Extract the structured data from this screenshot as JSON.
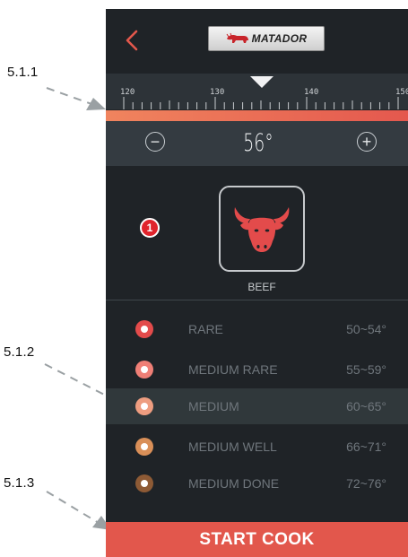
{
  "annotations": [
    {
      "label": "5.1.1"
    },
    {
      "label": "5.1.2"
    },
    {
      "label": "5.1.3"
    }
  ],
  "header": {
    "logo_text": "MATADOR",
    "icons": {
      "back": "chevron-left-icon",
      "logo": "bull-icon"
    }
  },
  "ruler": {
    "labels": [
      "120",
      "130",
      "140",
      "150"
    ],
    "pointer_icon": "triangle-down-icon"
  },
  "temperature": {
    "value": "56°",
    "minus": "−",
    "plus": "+"
  },
  "meat": {
    "badge": "1",
    "label": "BEEF",
    "icon": "bull-head-icon"
  },
  "doneness_levels": [
    {
      "name": "RARE",
      "range": "50~54°",
      "color": "#e34b4b"
    },
    {
      "name": "MEDIUM RARE",
      "range": "55~59°",
      "color": "#ef7f76"
    },
    {
      "name": "MEDIUM",
      "range": "60~65°",
      "color": "#ee9d80"
    },
    {
      "name": "MEDIUM WELL",
      "range": "66~71°",
      "color": "#d98f58"
    },
    {
      "name": "MEDIUM DONE",
      "range": "72~76°",
      "color": "#8d5a35"
    }
  ],
  "selected_level": "MEDIUM",
  "start_button": {
    "label": "START COOK"
  },
  "colors": {
    "accent": "#e2574c",
    "background": "#1f2327",
    "ruler_gradient_start": "#f0845e",
    "ruler_gradient_end": "#e4584e"
  }
}
